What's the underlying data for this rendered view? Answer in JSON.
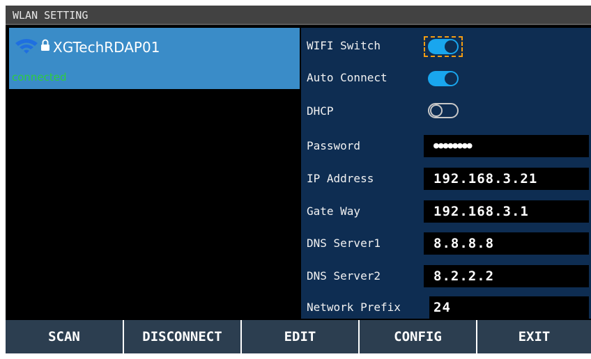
{
  "window": {
    "title": "WLAN SETTING"
  },
  "network_list": {
    "items": [
      {
        "ssid": "XGTechRDAP01",
        "status": "connected",
        "icon": "wifi-icon",
        "secured": true
      }
    ]
  },
  "settings": {
    "wifi_switch": {
      "label": "WIFI Switch",
      "on": true,
      "focused": true
    },
    "auto_connect": {
      "label": "Auto Connect",
      "on": true
    },
    "dhcp": {
      "label": "DHCP",
      "on": false
    },
    "password": {
      "label": "Password",
      "value": "●●●●●●●●"
    },
    "ip_address": {
      "label": "IP Address",
      "value": "192.168.3.21"
    },
    "gateway": {
      "label": "Gate Way",
      "value": "192.168.3.1"
    },
    "dns1": {
      "label": "DNS Server1",
      "value": "8.8.8.8"
    },
    "dns2": {
      "label": "DNS Server2",
      "value": "8.2.2.2"
    },
    "prefix": {
      "label": "Network Prefix",
      "value": "24"
    }
  },
  "buttons": {
    "scan": "SCAN",
    "disconnect": "DISCONNECT",
    "edit": "EDIT",
    "config": "CONFIG",
    "exit": "EXIT"
  },
  "colors": {
    "accent": "#3a8cc8",
    "panel": "#0e2d52",
    "toggle_on": "#19a6ee",
    "connected": "#2ecc40",
    "focus": "#f39c12"
  }
}
